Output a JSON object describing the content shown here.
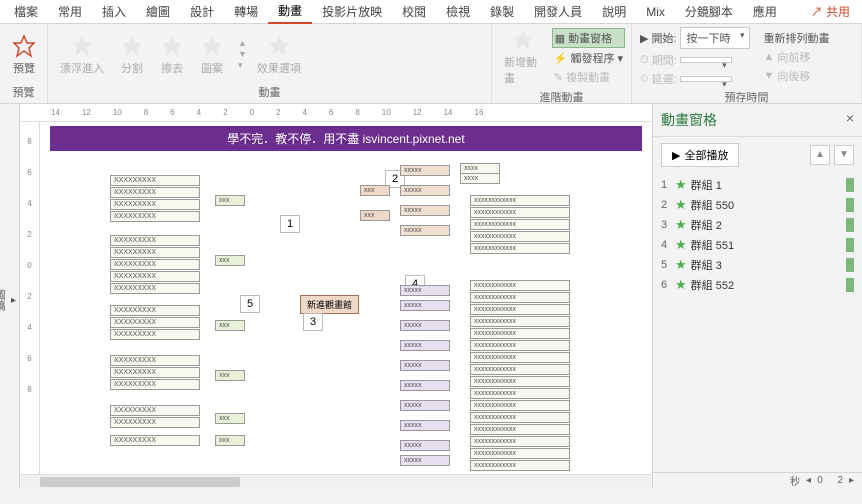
{
  "tabs": [
    "檔案",
    "常用",
    "插入",
    "繪圖",
    "設計",
    "轉場",
    "動畫",
    "投影片放映",
    "校閱",
    "檢視",
    "錄製",
    "開發人員",
    "說明",
    "Mix",
    "分鏡腳本",
    "應用"
  ],
  "active_tab": "動畫",
  "share": "共用",
  "ribbon": {
    "preview": {
      "label": "預覽",
      "group": "預覽"
    },
    "anim_group": {
      "label": "動畫",
      "items": [
        "漂浮進入",
        "分割",
        "擦去",
        "圖案"
      ],
      "options": "效果選項"
    },
    "advanced": {
      "label": "進階動畫",
      "add": "新增動畫",
      "pane": "動畫窗格",
      "trigger": "觸發程序",
      "copy": "複製動畫"
    },
    "timing": {
      "label": "預存時間",
      "start": "開始:",
      "start_val": "按一下時",
      "duration": "期間:",
      "delay": "延遲:",
      "reorder": "重新排列動畫",
      "forward": "向前移",
      "backward": "向後移"
    }
  },
  "outline": "圖稿",
  "slide": {
    "title": "學不完．教不停．用不盡 isvincent.pixnet.net",
    "callouts": [
      "1",
      "2",
      "3",
      "4",
      "5"
    ],
    "center": "新進觀畫館"
  },
  "anim_pane": {
    "title": "動畫窗格",
    "play": "全部播放",
    "items": [
      {
        "n": "1",
        "name": "群組 1"
      },
      {
        "n": "2",
        "name": "群組 550"
      },
      {
        "n": "3",
        "name": "群組 2"
      },
      {
        "n": "4",
        "name": "群組 551"
      },
      {
        "n": "5",
        "name": "群組 3"
      },
      {
        "n": "6",
        "name": "群組 552"
      }
    ]
  },
  "status": {
    "sec": "秒",
    "zero": "0",
    "two": "2"
  },
  "ruler_h": [
    "14",
    "12",
    "10",
    "8",
    "6",
    "4",
    "2",
    "0",
    "2",
    "4",
    "6",
    "8",
    "10",
    "12",
    "14",
    "16"
  ],
  "ruler_v": [
    "8",
    "6",
    "4",
    "2",
    "0",
    "2",
    "4",
    "6",
    "8"
  ]
}
